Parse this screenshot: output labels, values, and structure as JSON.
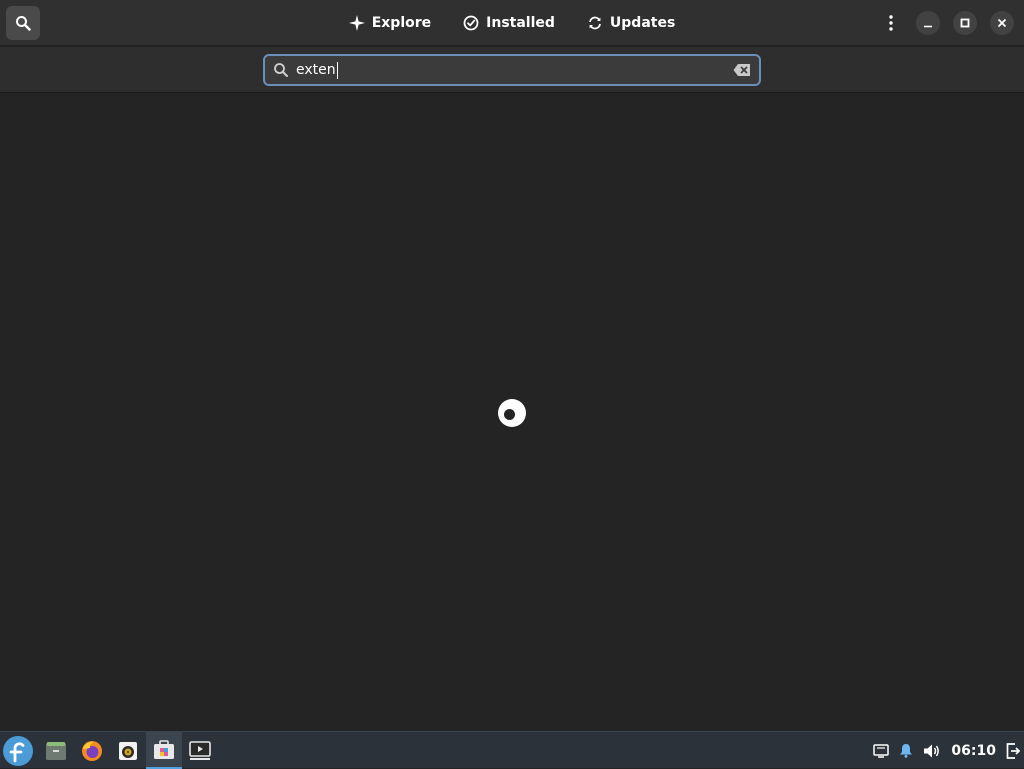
{
  "header": {
    "tabs": [
      {
        "label": "Explore",
        "icon": "sparkle-icon"
      },
      {
        "label": "Installed",
        "icon": "check-circle-icon"
      },
      {
        "label": "Updates",
        "icon": "refresh-icon"
      }
    ]
  },
  "search": {
    "value": "exten"
  },
  "taskbar": {
    "launchers": [
      {
        "name": "fedora-menu-icon"
      },
      {
        "name": "files-icon"
      },
      {
        "name": "firefox-icon"
      },
      {
        "name": "rhythmbox-icon"
      },
      {
        "name": "software-icon",
        "active": true
      },
      {
        "name": "video-player-icon"
      }
    ],
    "clock": "06:10"
  },
  "colors": {
    "accent": "#4ea3e0",
    "focus_border": "#6a8fb8",
    "background": "#242424"
  }
}
